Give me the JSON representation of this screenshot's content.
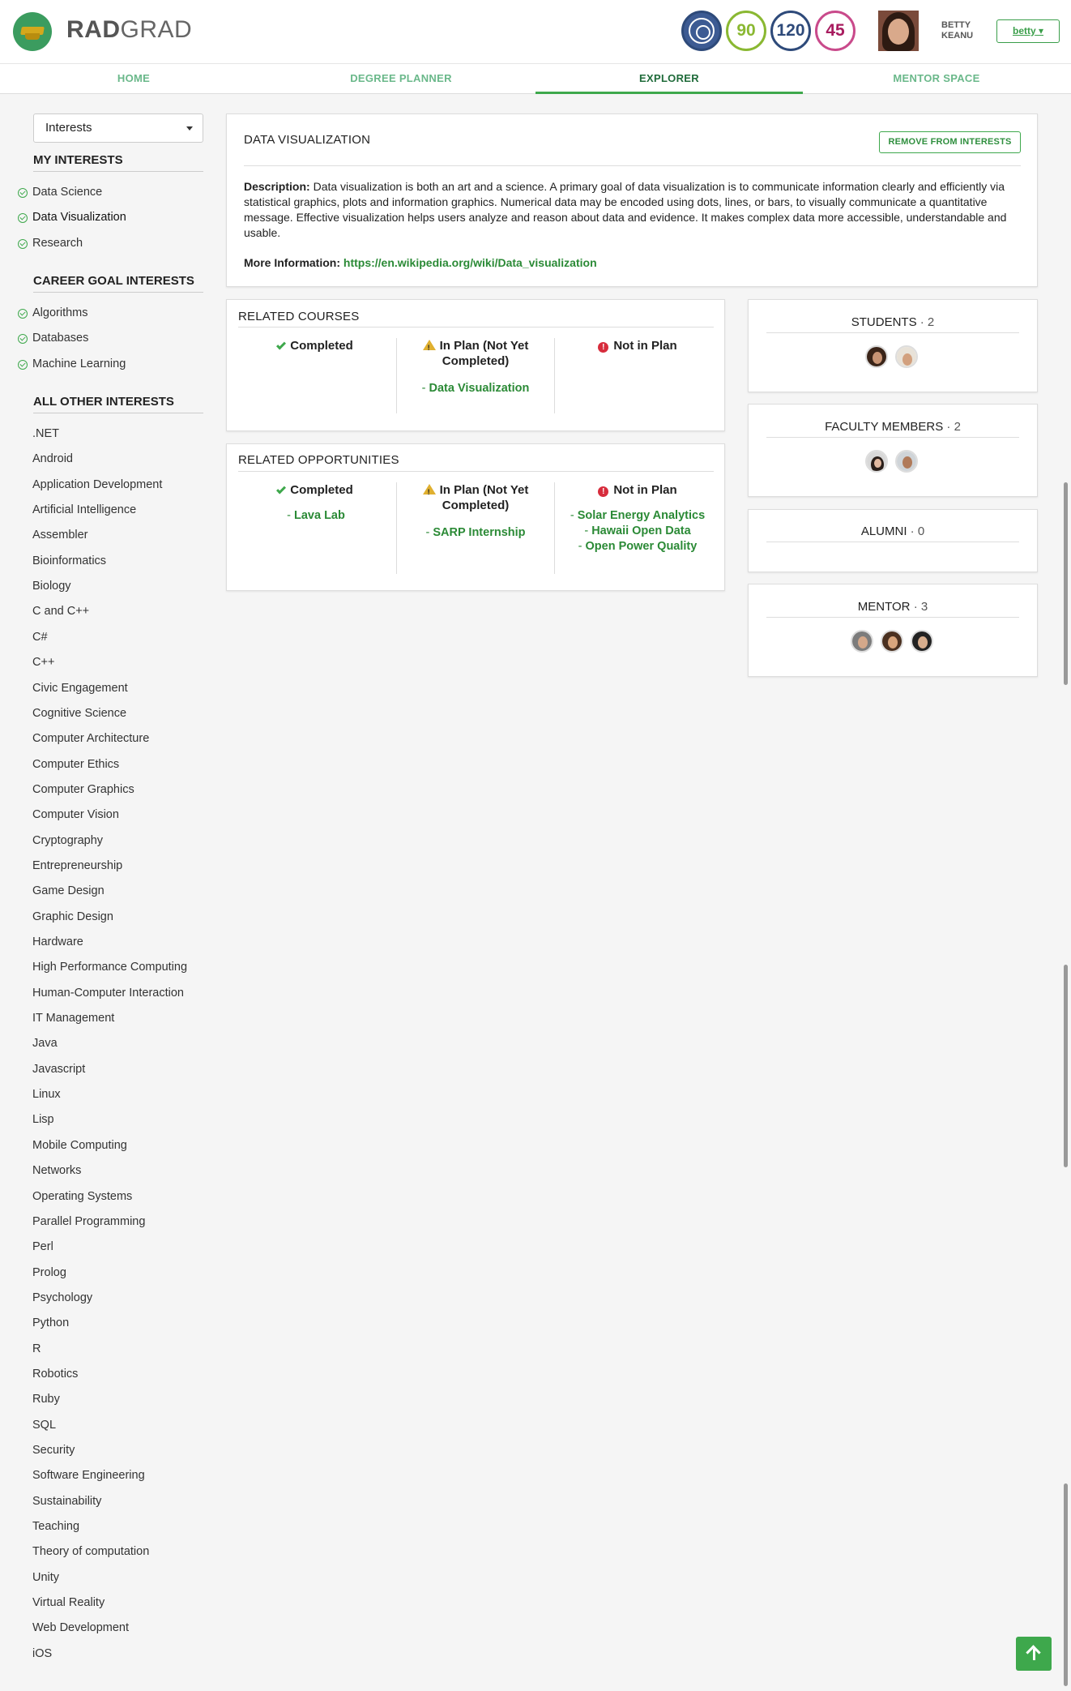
{
  "header": {
    "brand_bold": "RAD",
    "brand_rest": "GRAD",
    "ice": {
      "innovation": "90",
      "competency": "120",
      "experience": "45"
    },
    "user_first": "BETTY",
    "user_last": "KEANU",
    "user_button": "betty",
    "colors": {
      "innovation": "#8ab832",
      "competency": "#2e4a7a",
      "experience": "#a81c5f"
    }
  },
  "nav": {
    "home": "HOME",
    "degree_planner": "DEGREE PLANNER",
    "explorer": "EXPLORER",
    "mentor_space": "MENTOR SPACE"
  },
  "sidebar": {
    "dropdown_value": "Interests",
    "my_interests_title": "MY INTERESTS",
    "my_interests": [
      "Data Science",
      "Data Visualization",
      "Research"
    ],
    "career_title": "CAREER GOAL INTERESTS",
    "career": [
      "Algorithms",
      "Databases",
      "Machine Learning"
    ],
    "other_title": "ALL OTHER INTERESTS",
    "other": [
      ".NET",
      "Android",
      "Application Development",
      "Artificial Intelligence",
      "Assembler",
      "Bioinformatics",
      "Biology",
      "C and C++",
      "C#",
      "C++",
      "Civic Engagement",
      "Cognitive Science",
      "Computer Architecture",
      "Computer Ethics",
      "Computer Graphics",
      "Computer Vision",
      "Cryptography",
      "Entrepreneurship",
      "Game Design",
      "Graphic Design",
      "Hardware",
      "High Performance Computing",
      "Human-Computer Interaction",
      "IT Management",
      "Java",
      "Javascript",
      "Linux",
      "Lisp",
      "Mobile Computing",
      "Networks",
      "Operating Systems",
      "Parallel Programming",
      "Perl",
      "Prolog",
      "Psychology",
      "Python",
      "R",
      "Robotics",
      "Ruby",
      "SQL",
      "Security",
      "Software Engineering",
      "Sustainability",
      "Teaching",
      "Theory of computation",
      "Unity",
      "Virtual Reality",
      "Web Development",
      "iOS"
    ]
  },
  "main": {
    "title": "DATA VISUALIZATION",
    "remove_button": "REMOVE FROM INTERESTS",
    "description_label": "Description:",
    "description": "Data visualization is both an art and a science. A primary goal of data visualization is to communicate information clearly and efficiently via statistical graphics, plots and information graphics. Numerical data may be encoded using dots, lines, or bars, to visually communicate a quantitative message. Effective visualization helps users analyze and reason about data and evidence. It makes complex data more accessible, understandable and usable.",
    "more_label": "More Information:",
    "more_link": "https://en.wikipedia.org/wiki/Data_visualization",
    "courses": {
      "title": "RELATED COURSES",
      "completed": "Completed",
      "in_plan": "In Plan (Not Yet Completed)",
      "not_in_plan": "Not in Plan",
      "in_plan_items": [
        "Data Visualization"
      ]
    },
    "opportunities": {
      "title": "RELATED OPPORTUNITIES",
      "completed": "Completed",
      "in_plan": "In Plan (Not Yet Completed)",
      "not_in_plan": "Not in Plan",
      "completed_items": [
        "Lava Lab"
      ],
      "in_plan_items": [
        "SARP Internship"
      ],
      "not_in_plan_items": [
        "Solar Energy Analytics",
        "Hawaii Open Data",
        "Open Power Quality"
      ]
    }
  },
  "stats": {
    "students_label": "STUDENTS",
    "students_count": "2",
    "faculty_label": "FACULTY MEMBERS",
    "faculty_count": "2",
    "alumni_label": "ALUMNI",
    "alumni_count": "0",
    "mentor_label": "MENTOR",
    "mentor_count": "3",
    "dot": "·"
  }
}
